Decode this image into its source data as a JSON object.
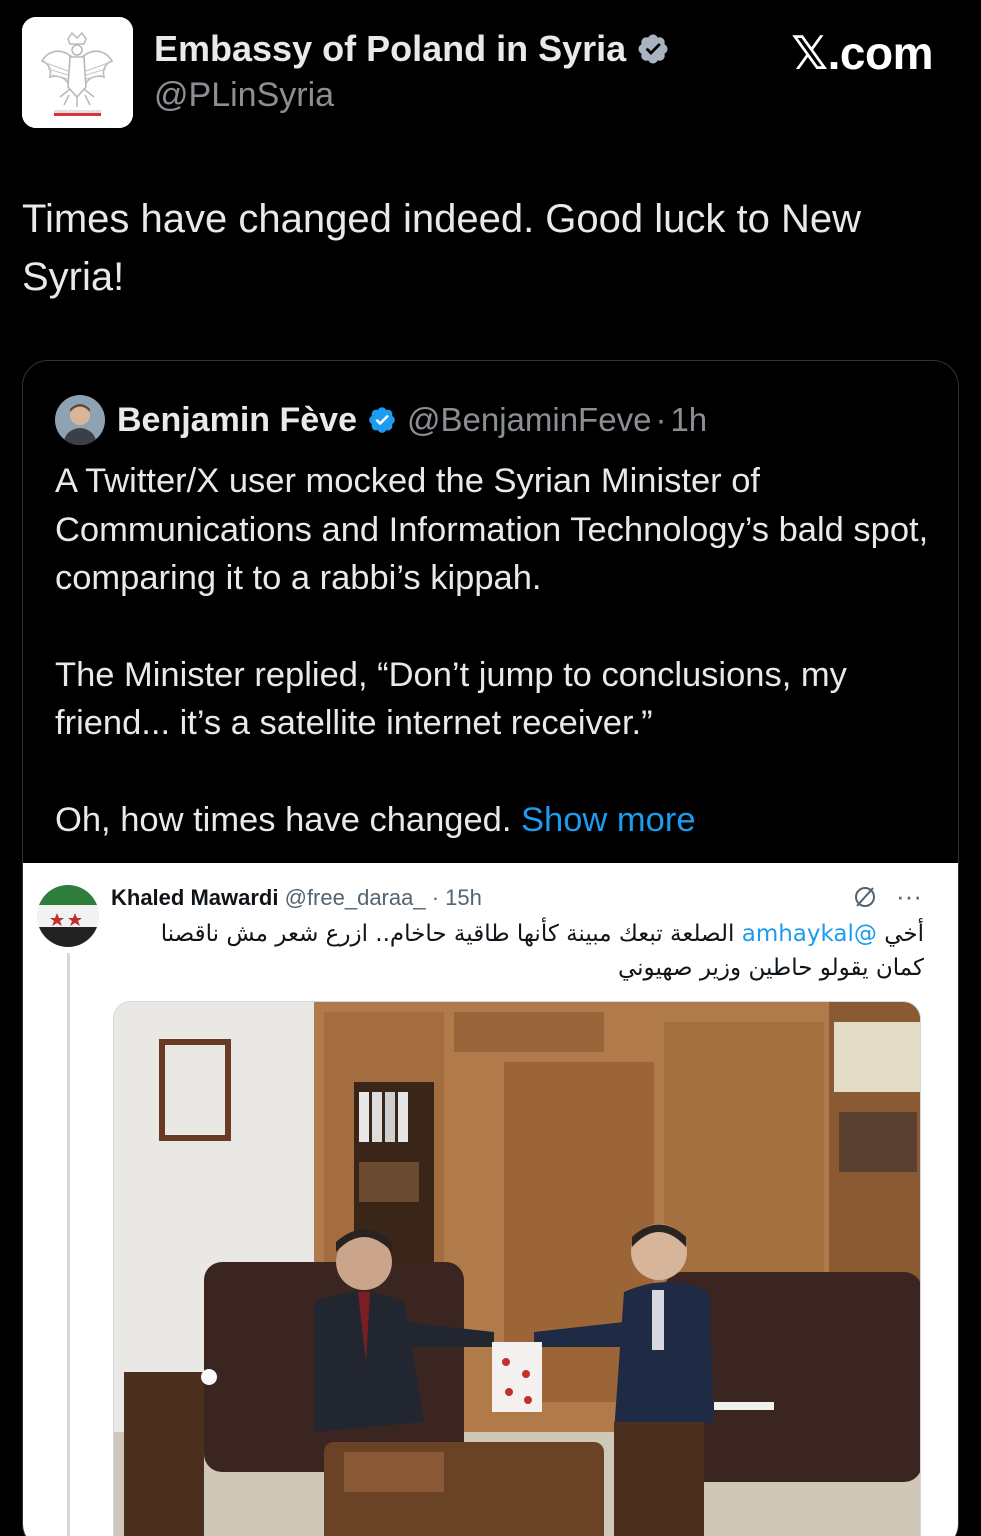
{
  "account": {
    "display_name": "Embassy of Poland in Syria",
    "handle": "@PLinSyria",
    "verified": true,
    "avatar_icon": "polish-eagle-emblem"
  },
  "brand": {
    "label": "𝕏.com"
  },
  "tweet": {
    "text": "Times have changed indeed. Good luck to New Syria!"
  },
  "quoted_tweet": {
    "author_name": "Benjamin Fève",
    "author_handle": "@BenjaminFeve",
    "separator": "·",
    "time": "1h",
    "verified": true,
    "paragraphs": [
      "A Twitter/X user mocked the Syrian Minister of Communications and Information Technology’s bald spot, comparing it to a rabbi’s kippah.",
      "The Minister  replied, “Don’t jump to conclusions, my friend... it’s a satellite internet receiver.”",
      "Oh, how times have changed."
    ],
    "show_more_label": "Show more"
  },
  "embedded_tweet": {
    "author_name": "Khaled Mawardi",
    "author_handle": "@free_daraa_",
    "separator": "·",
    "time": "15h",
    "text_prefix": "أخي",
    "mention": "@amhaykal",
    "text_rest": "الصلعة تبعك مبينة كأنها طاقية حاخام.. ازرع شعر مش ناقصنا كمان يقولو حاطين وزير صهيوني",
    "more_icon": "ellipsis-icon",
    "grok_icon": "slash-circle-icon"
  },
  "colors": {
    "background": "#000000",
    "text": "#e7e9ea",
    "secondary_text": "#8b8f94",
    "link": "#1d9bf0",
    "verified": "#1d9bf0",
    "border": "#2f3336"
  }
}
